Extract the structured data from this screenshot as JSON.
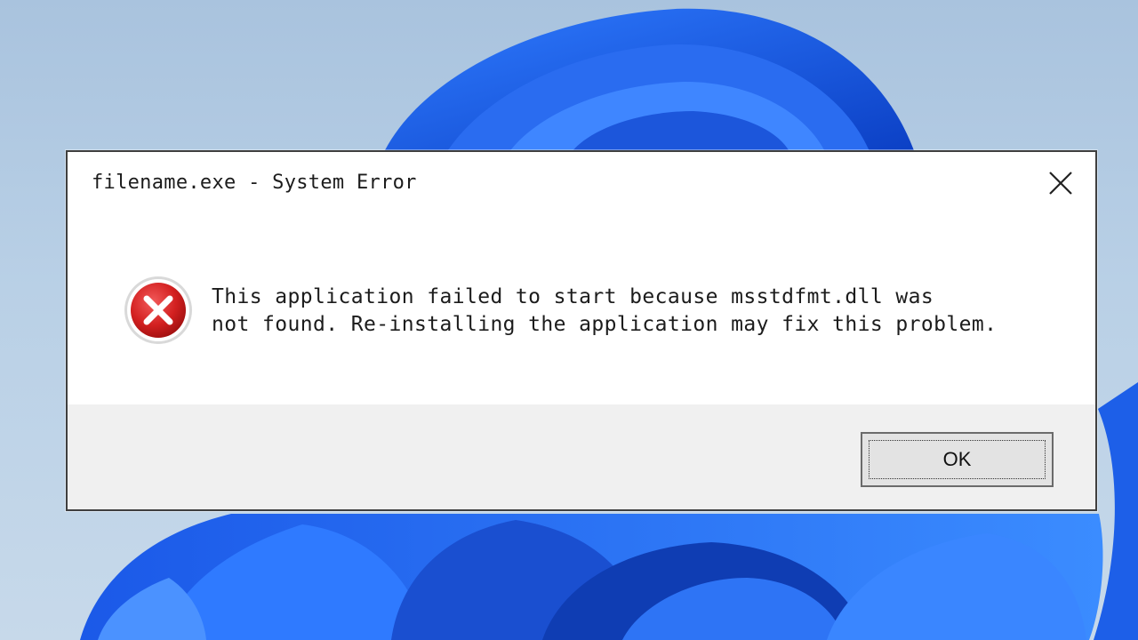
{
  "dialog": {
    "title": "filename.exe - System Error",
    "message": "This application failed to start because msstdfmt.dll was\nnot found. Re-installing the application may fix this problem.",
    "ok_label": "OK",
    "icon": "error-icon",
    "close_icon": "close-icon"
  },
  "colors": {
    "dialog_background": "#ffffff",
    "footer_background": "#f0f0f0",
    "error_red": "#d32020",
    "wallpaper_blue": "#1a5fe6"
  }
}
